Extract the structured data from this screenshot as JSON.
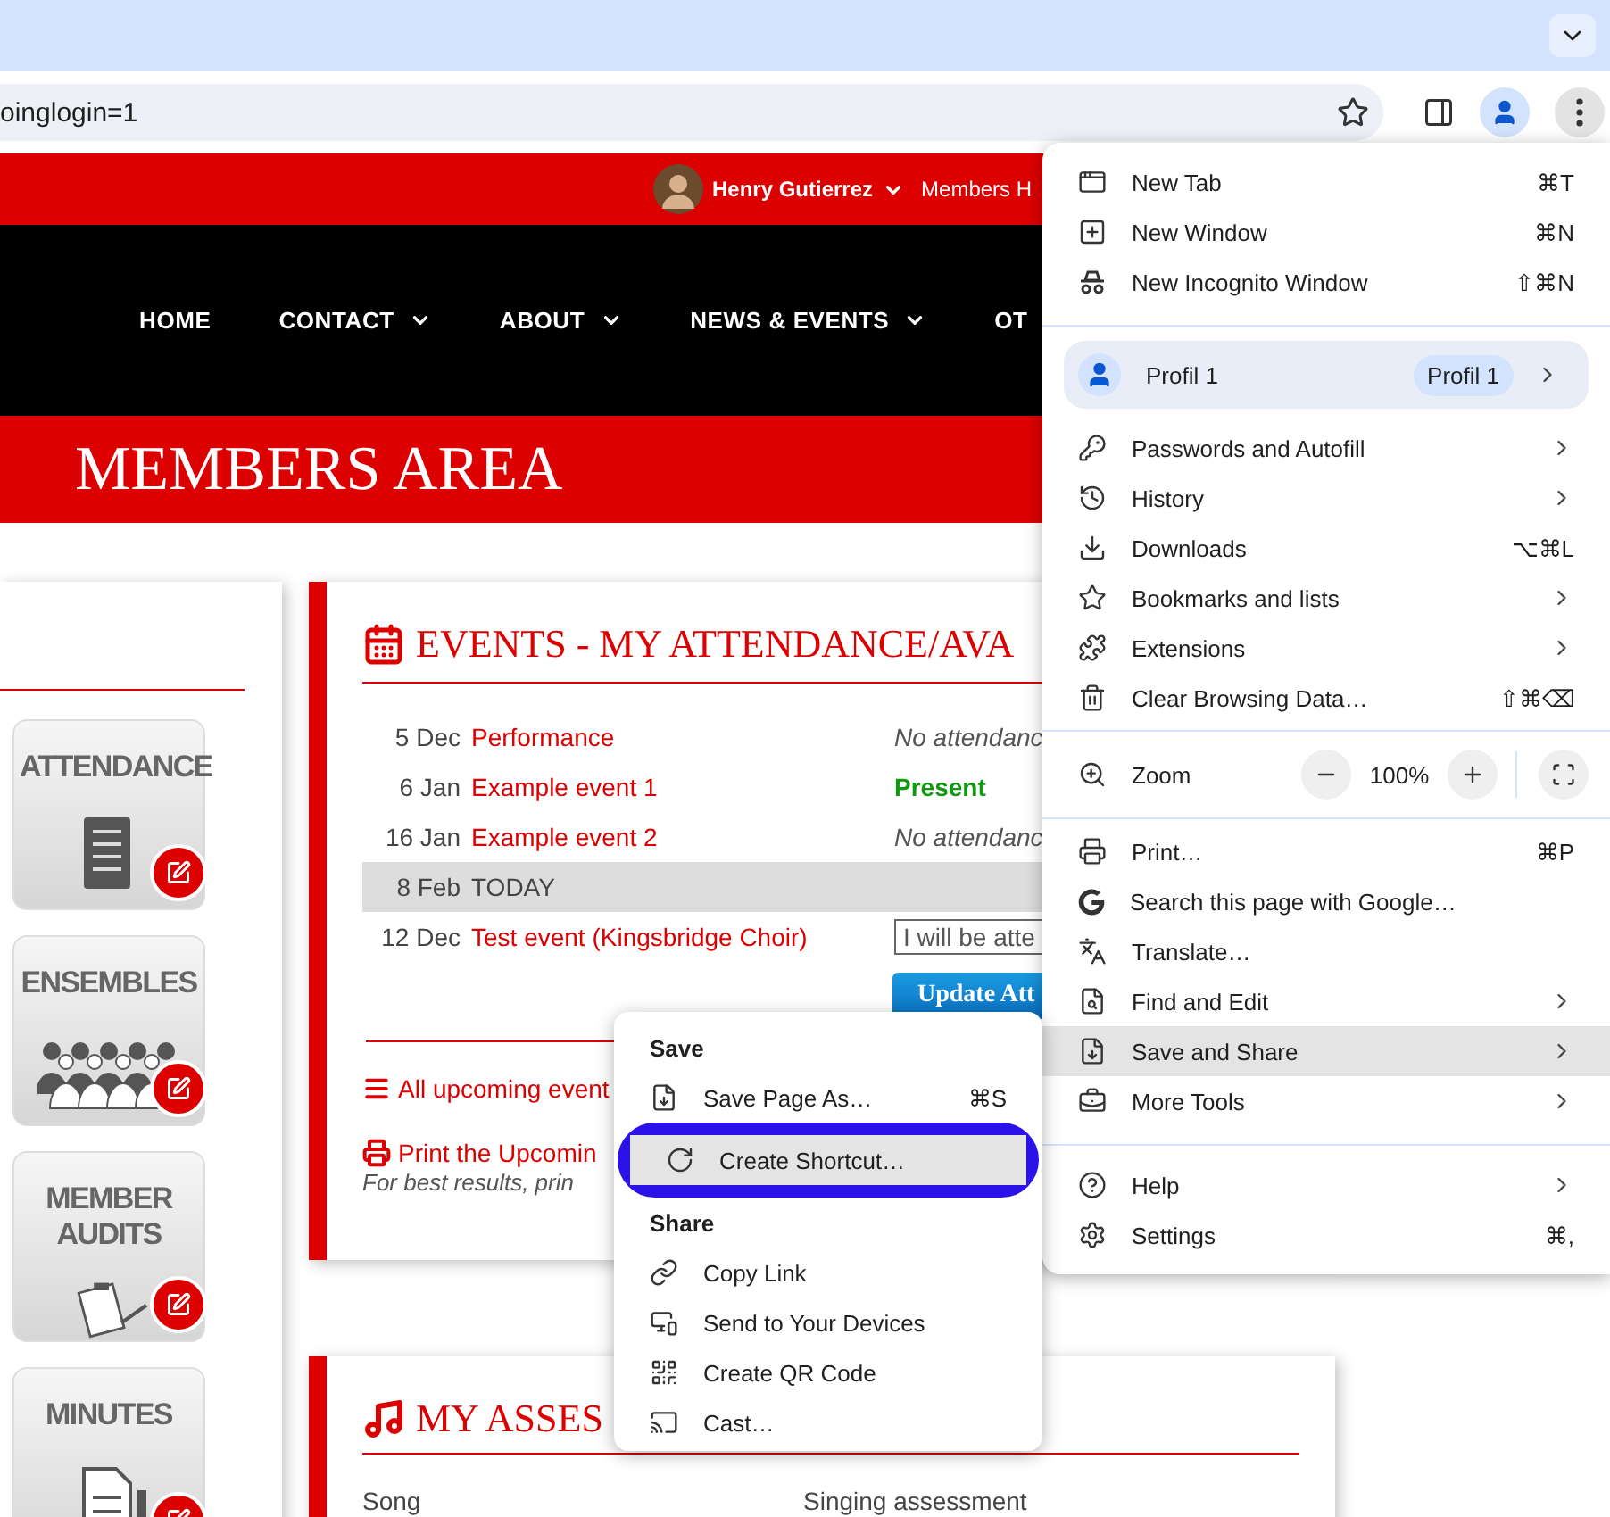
{
  "browser": {
    "url": "oinglogin=1"
  },
  "site_header": {
    "user_name": "Henry Gutierrez",
    "members_link": "Members H"
  },
  "nav": [
    {
      "label": "HOME",
      "dropdown": false
    },
    {
      "label": "CONTACT",
      "dropdown": true
    },
    {
      "label": "ABOUT",
      "dropdown": true
    },
    {
      "label": "NEWS & EVENTS",
      "dropdown": true
    },
    {
      "label": "OT",
      "dropdown": false
    }
  ],
  "banner": {
    "title": "MEMBERS AREA"
  },
  "tiles": [
    {
      "label": "ATTENDANCE",
      "kind": "attendance"
    },
    {
      "label": "ENSEMBLES",
      "kind": "ensembles"
    },
    {
      "label": "MEMBER AUDITS",
      "kind": "audits"
    },
    {
      "label": "MINUTES",
      "kind": "minutes"
    }
  ],
  "events": {
    "title": "EVENTS - MY ATTENDANCE/AVA",
    "rows": [
      {
        "kind": "event",
        "date": "5 Dec",
        "name": "Performance",
        "status": "No attendanc",
        "present": false
      },
      {
        "kind": "event",
        "date": "6 Jan",
        "name": "Example event 1",
        "status": "Present",
        "present": true
      },
      {
        "kind": "event",
        "date": "16 Jan",
        "name": "Example event 2",
        "status": "No attendanc",
        "present": false
      },
      {
        "kind": "today",
        "date": "8 Feb",
        "name": "TODAY"
      },
      {
        "kind": "choice",
        "date": "12 Dec",
        "name": "Test event (Kingsbridge Choir)",
        "value": "I will be atte"
      }
    ],
    "button": "Update Att",
    "links": [
      "All upcoming event",
      "Print the Upcomin"
    ],
    "note": "For best results, prin"
  },
  "assessments": {
    "title": "MY ASSES",
    "columns": [
      "Song",
      "Singing assessment"
    ]
  },
  "save_menu": {
    "sections": [
      {
        "heading": "Save",
        "items": [
          {
            "label": "Save Page As…",
            "shortcut": "⌘S",
            "circled": false
          },
          {
            "label": "Create Shortcut…",
            "circled": true
          }
        ]
      },
      {
        "heading": "Share",
        "items": [
          {
            "label": "Copy Link",
            "circled": false
          },
          {
            "label": "Send to Your Devices",
            "circled": false
          },
          {
            "label": "Create QR Code",
            "circled": false
          },
          {
            "label": "Cast…",
            "circled": false
          }
        ]
      }
    ]
  },
  "chrome_menu": {
    "groups": [
      {
        "items": [
          {
            "kind": "item",
            "label": "New Tab",
            "shortcut": "⌘T",
            "submenu": false,
            "selected": false
          },
          {
            "kind": "item",
            "label": "New Window",
            "shortcut": "⌘N",
            "submenu": false,
            "selected": false
          },
          {
            "kind": "item",
            "label": "New Incognito Window",
            "shortcut": "⇧⌘N",
            "submenu": false,
            "selected": false
          }
        ]
      },
      {
        "items": [
          {
            "kind": "profile",
            "label": "Profil 1",
            "badge": "Profil 1",
            "submenu": true,
            "selected": false
          },
          {
            "kind": "item",
            "label": "Passwords and Autofill",
            "submenu": true,
            "selected": false
          },
          {
            "kind": "item",
            "label": "History",
            "submenu": true,
            "selected": false
          },
          {
            "kind": "item",
            "label": "Downloads",
            "shortcut": "⌥⌘L",
            "submenu": false,
            "selected": false
          },
          {
            "kind": "item",
            "label": "Bookmarks and lists",
            "submenu": true,
            "selected": false
          },
          {
            "kind": "item",
            "label": "Extensions",
            "submenu": true,
            "selected": false
          },
          {
            "kind": "item",
            "label": "Clear Browsing Data…",
            "shortcut": "⇧⌘⌫",
            "submenu": false,
            "selected": false
          }
        ]
      },
      {
        "items": [
          {
            "kind": "zoom",
            "label": "Zoom",
            "value": "100%"
          }
        ]
      },
      {
        "items": [
          {
            "kind": "item",
            "label": "Print…",
            "shortcut": "⌘P",
            "submenu": false,
            "selected": false
          },
          {
            "kind": "item",
            "label": "Search this page with Google…",
            "submenu": false,
            "selected": false
          },
          {
            "kind": "item",
            "label": "Translate…",
            "submenu": false,
            "selected": false
          },
          {
            "kind": "item",
            "label": "Find and Edit",
            "submenu": true,
            "selected": false
          },
          {
            "kind": "item",
            "label": "Save and Share",
            "submenu": true,
            "selected": true
          },
          {
            "kind": "item",
            "label": "More Tools",
            "submenu": true,
            "selected": false
          }
        ]
      },
      {
        "items": [
          {
            "kind": "item",
            "label": "Help",
            "submenu": true,
            "selected": false
          },
          {
            "kind": "item",
            "label": "Settings",
            "shortcut": "⌘,",
            "submenu": false,
            "selected": false
          }
        ]
      }
    ]
  }
}
